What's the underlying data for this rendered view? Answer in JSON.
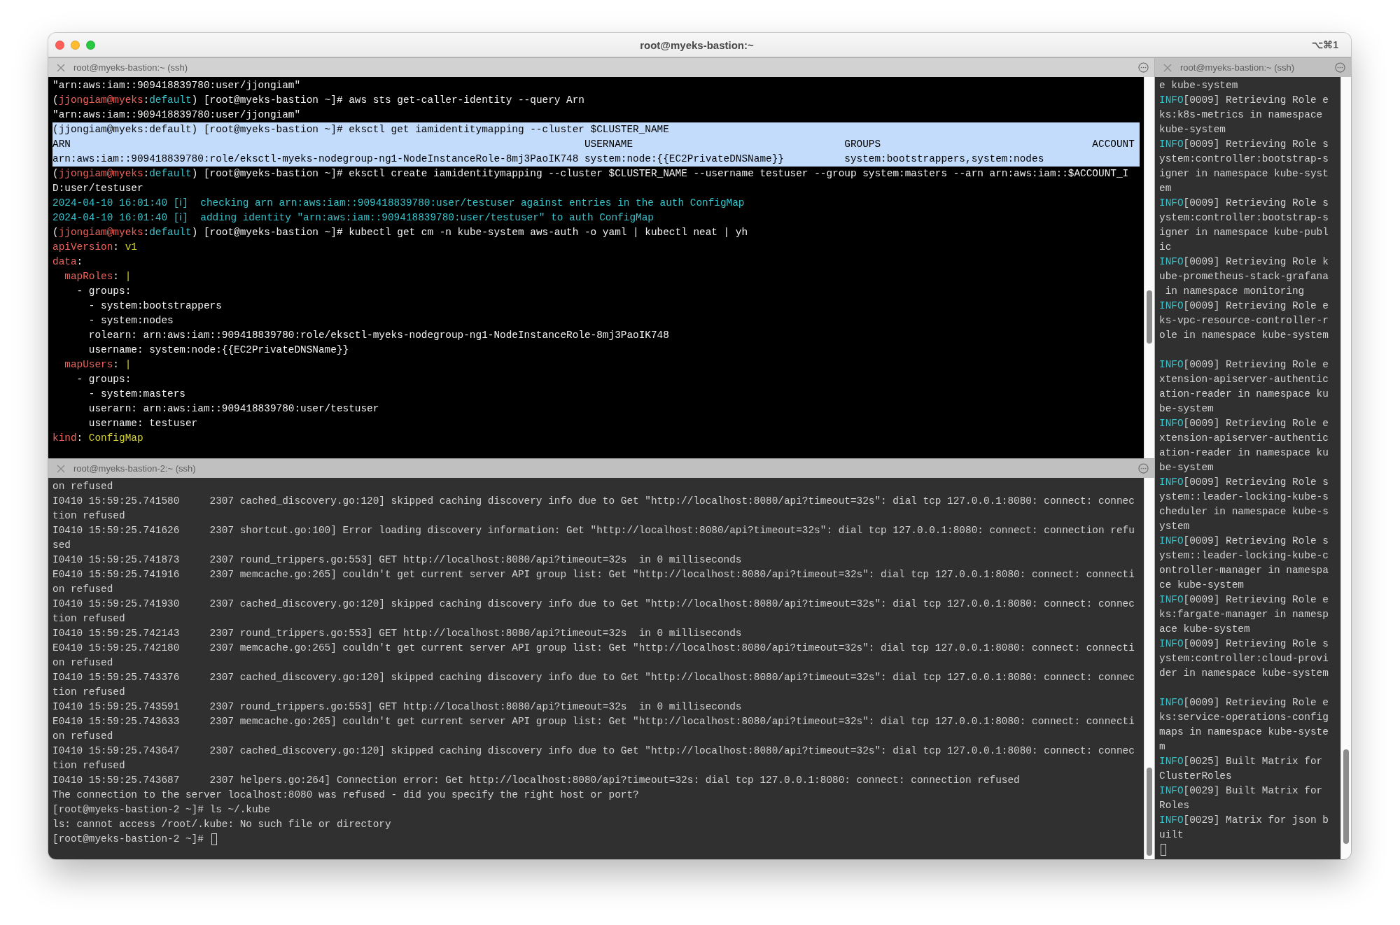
{
  "window": {
    "title": "root@myeks-bastion:~",
    "shortcut": "⌥⌘1"
  },
  "panes": [
    {
      "title": "root@myeks-bastion:~ (ssh)",
      "active": true,
      "lines": [
        {
          "kind": "text",
          "selected": false,
          "segments": [
            {
              "kind": "plain",
              "text": "\"arn:aws:iam::909418839780:user/jjongiam\""
            }
          ]
        },
        {
          "kind": "text",
          "selected": false,
          "segments": [
            {
              "kind": "plain",
              "text": "("
            },
            {
              "kind": "user",
              "text": "jjongiam@myeks"
            },
            {
              "kind": "plain",
              "text": ":"
            },
            {
              "kind": "context",
              "text": "default"
            },
            {
              "kind": "plain",
              "text": ") [root@myeks-bastion ~]# aws sts get-caller-identity --query Arn"
            }
          ]
        },
        {
          "kind": "text",
          "selected": false,
          "segments": [
            {
              "kind": "plain",
              "text": "\"arn:aws:iam::909418839780:user/jjongiam\""
            }
          ]
        },
        {
          "kind": "text",
          "selected": true,
          "segments": [
            {
              "kind": "plain",
              "text": "(jjongiam@myeks:default) [root@myeks-bastion ~]# eksctl get iamidentitymapping --cluster $CLUSTER_NAME"
            }
          ]
        },
        {
          "kind": "text",
          "selected": true,
          "segments": [
            {
              "kind": "plain",
              "text": "ARN                                                                                     USERNAME                                   GROUPS                                   ACCOUNT"
            }
          ]
        },
        {
          "kind": "text",
          "selected": true,
          "segments": [
            {
              "kind": "plain",
              "text": "arn:aws:iam::909418839780:role/eksctl-myeks-nodegroup-ng1-NodeInstanceRole-8mj3PaoIK748 system:node:{{EC2PrivateDNSName}}          system:bootstrappers,system:nodes"
            }
          ]
        },
        {
          "kind": "text",
          "selected": false,
          "segments": [
            {
              "kind": "plain",
              "text": "("
            },
            {
              "kind": "user",
              "text": "jjongiam@myeks"
            },
            {
              "kind": "plain",
              "text": ":"
            },
            {
              "kind": "context",
              "text": "default"
            },
            {
              "kind": "plain",
              "text": ") [root@myeks-bastion ~]# eksctl create iamidentitymapping --cluster $CLUSTER_NAME --username testuser --group system:masters --arn arn:aws:iam::$ACCOUNT_I"
            }
          ]
        },
        {
          "kind": "text",
          "selected": false,
          "segments": [
            {
              "kind": "plain",
              "text": "D:user/testuser"
            }
          ]
        },
        {
          "kind": "text",
          "selected": false,
          "segments": [
            {
              "kind": "info",
              "text": "2024-04-10 16:01:40 [ℹ]  checking arn arn:aws:iam::909418839780:user/testuser against entries in the auth ConfigMap"
            }
          ]
        },
        {
          "kind": "text",
          "selected": false,
          "segments": [
            {
              "kind": "info",
              "text": "2024-04-10 16:01:40 [ℹ]  adding identity \"arn:aws:iam::909418839780:user/testuser\" to auth ConfigMap"
            }
          ]
        },
        {
          "kind": "text",
          "selected": false,
          "segments": [
            {
              "kind": "plain",
              "text": "("
            },
            {
              "kind": "user",
              "text": "jjongiam@myeks"
            },
            {
              "kind": "plain",
              "text": ":"
            },
            {
              "kind": "context",
              "text": "default"
            },
            {
              "kind": "plain",
              "text": ") [root@myeks-bastion ~]# kubectl get cm -n kube-system aws-auth -o yaml | kubectl neat | yh"
            }
          ]
        },
        {
          "kind": "text",
          "selected": false,
          "segments": [
            {
              "kind": "key",
              "text": "apiVersion"
            },
            {
              "kind": "plain",
              "text": ": "
            },
            {
              "kind": "value",
              "text": "v1"
            }
          ]
        },
        {
          "kind": "text",
          "selected": false,
          "segments": [
            {
              "kind": "key",
              "text": "data"
            },
            {
              "kind": "plain",
              "text": ":"
            }
          ]
        },
        {
          "kind": "text",
          "selected": false,
          "segments": [
            {
              "kind": "key",
              "text": "  mapRoles"
            },
            {
              "kind": "plain",
              "text": ": "
            },
            {
              "kind": "value",
              "text": "|"
            }
          ]
        },
        {
          "kind": "text",
          "selected": false,
          "segments": [
            {
              "kind": "plain",
              "text": "    - groups:"
            }
          ]
        },
        {
          "kind": "text",
          "selected": false,
          "segments": [
            {
              "kind": "plain",
              "text": "      - system:bootstrappers"
            }
          ]
        },
        {
          "kind": "text",
          "selected": false,
          "segments": [
            {
              "kind": "plain",
              "text": "      - system:nodes"
            }
          ]
        },
        {
          "kind": "text",
          "selected": false,
          "segments": [
            {
              "kind": "plain",
              "text": "      rolearn: arn:aws:iam::909418839780:role/eksctl-myeks-nodegroup-ng1-NodeInstanceRole-8mj3PaoIK748"
            }
          ]
        },
        {
          "kind": "text",
          "selected": false,
          "segments": [
            {
              "kind": "plain",
              "text": "      username: system:node:{{EC2PrivateDNSName}}"
            }
          ]
        },
        {
          "kind": "text",
          "selected": false,
          "segments": [
            {
              "kind": "key",
              "text": "  mapUsers"
            },
            {
              "kind": "plain",
              "text": ": "
            },
            {
              "kind": "value",
              "text": "|"
            }
          ]
        },
        {
          "kind": "text",
          "selected": false,
          "segments": [
            {
              "kind": "plain",
              "text": "    - groups:"
            }
          ]
        },
        {
          "kind": "text",
          "selected": false,
          "segments": [
            {
              "kind": "plain",
              "text": "      - system:masters"
            }
          ]
        },
        {
          "kind": "text",
          "selected": false,
          "segments": [
            {
              "kind": "plain",
              "text": "      userarn: arn:aws:iam::909418839780:user/testuser"
            }
          ]
        },
        {
          "kind": "text",
          "selected": false,
          "segments": [
            {
              "kind": "plain",
              "text": "      username: testuser"
            }
          ]
        },
        {
          "kind": "text",
          "selected": false,
          "segments": [
            {
              "kind": "key",
              "text": "kind"
            },
            {
              "kind": "plain",
              "text": ": "
            },
            {
              "kind": "value",
              "text": "ConfigMap"
            }
          ]
        }
      ]
    },
    {
      "title": "root@myeks-bastion-2:~ (ssh)",
      "active": false,
      "lines": [
        {
          "kind": "text",
          "segments": [
            {
              "kind": "plain",
              "text": "on refused"
            }
          ]
        },
        {
          "kind": "text",
          "segments": [
            {
              "kind": "plain",
              "text": "I0410 15:59:25.741580     2307 cached_discovery.go:120] skipped caching discovery info due to Get \"http://localhost:8080/api?timeout=32s\": dial tcp 127.0.0.1:8080: connect: connec"
            }
          ]
        },
        {
          "kind": "text",
          "segments": [
            {
              "kind": "plain",
              "text": "tion refused"
            }
          ]
        },
        {
          "kind": "text",
          "segments": [
            {
              "kind": "plain",
              "text": "I0410 15:59:25.741626     2307 shortcut.go:100] Error loading discovery information: Get \"http://localhost:8080/api?timeout=32s\": dial tcp 127.0.0.1:8080: connect: connection refu"
            }
          ]
        },
        {
          "kind": "text",
          "segments": [
            {
              "kind": "plain",
              "text": "sed"
            }
          ]
        },
        {
          "kind": "text",
          "segments": [
            {
              "kind": "plain",
              "text": "I0410 15:59:25.741873     2307 round_trippers.go:553] GET http://localhost:8080/api?timeout=32s  in 0 milliseconds"
            }
          ]
        },
        {
          "kind": "text",
          "segments": [
            {
              "kind": "plain",
              "text": "E0410 15:59:25.741916     2307 memcache.go:265] couldn't get current server API group list: Get \"http://localhost:8080/api?timeout=32s\": dial tcp 127.0.0.1:8080: connect: connecti"
            }
          ]
        },
        {
          "kind": "text",
          "segments": [
            {
              "kind": "plain",
              "text": "on refused"
            }
          ]
        },
        {
          "kind": "text",
          "segments": [
            {
              "kind": "plain",
              "text": "I0410 15:59:25.741930     2307 cached_discovery.go:120] skipped caching discovery info due to Get \"http://localhost:8080/api?timeout=32s\": dial tcp 127.0.0.1:8080: connect: connec"
            }
          ]
        },
        {
          "kind": "text",
          "segments": [
            {
              "kind": "plain",
              "text": "tion refused"
            }
          ]
        },
        {
          "kind": "text",
          "segments": [
            {
              "kind": "plain",
              "text": "I0410 15:59:25.742143     2307 round_trippers.go:553] GET http://localhost:8080/api?timeout=32s  in 0 milliseconds"
            }
          ]
        },
        {
          "kind": "text",
          "segments": [
            {
              "kind": "plain",
              "text": "E0410 15:59:25.742180     2307 memcache.go:265] couldn't get current server API group list: Get \"http://localhost:8080/api?timeout=32s\": dial tcp 127.0.0.1:8080: connect: connecti"
            }
          ]
        },
        {
          "kind": "text",
          "segments": [
            {
              "kind": "plain",
              "text": "on refused"
            }
          ]
        },
        {
          "kind": "text",
          "segments": [
            {
              "kind": "plain",
              "text": "I0410 15:59:25.743376     2307 cached_discovery.go:120] skipped caching discovery info due to Get \"http://localhost:8080/api?timeout=32s\": dial tcp 127.0.0.1:8080: connect: connec"
            }
          ]
        },
        {
          "kind": "text",
          "segments": [
            {
              "kind": "plain",
              "text": "tion refused"
            }
          ]
        },
        {
          "kind": "text",
          "segments": [
            {
              "kind": "plain",
              "text": "I0410 15:59:25.743591     2307 round_trippers.go:553] GET http://localhost:8080/api?timeout=32s  in 0 milliseconds"
            }
          ]
        },
        {
          "kind": "text",
          "segments": [
            {
              "kind": "plain",
              "text": "E0410 15:59:25.743633     2307 memcache.go:265] couldn't get current server API group list: Get \"http://localhost:8080/api?timeout=32s\": dial tcp 127.0.0.1:8080: connect: connecti"
            }
          ]
        },
        {
          "kind": "text",
          "segments": [
            {
              "kind": "plain",
              "text": "on refused"
            }
          ]
        },
        {
          "kind": "text",
          "segments": [
            {
              "kind": "plain",
              "text": "I0410 15:59:25.743647     2307 cached_discovery.go:120] skipped caching discovery info due to Get \"http://localhost:8080/api?timeout=32s\": dial tcp 127.0.0.1:8080: connect: connec"
            }
          ]
        },
        {
          "kind": "text",
          "segments": [
            {
              "kind": "plain",
              "text": "tion refused"
            }
          ]
        },
        {
          "kind": "text",
          "segments": [
            {
              "kind": "plain",
              "text": "I0410 15:59:25.743687     2307 helpers.go:264] Connection error: Get http://localhost:8080/api?timeout=32s: dial tcp 127.0.0.1:8080: connect: connection refused"
            }
          ]
        },
        {
          "kind": "text",
          "segments": [
            {
              "kind": "plain",
              "text": "The connection to the server localhost:8080 was refused - did you specify the right host or port?"
            }
          ]
        },
        {
          "kind": "text",
          "segments": [
            {
              "kind": "plain",
              "text": "[root@myeks-bastion-2 ~]# ls ~/.kube"
            }
          ]
        },
        {
          "kind": "text",
          "segments": [
            {
              "kind": "plain",
              "text": "ls: cannot access /root/.kube: No such file or directory"
            }
          ]
        },
        {
          "kind": "text",
          "cursor": true,
          "segments": [
            {
              "kind": "plain",
              "text": "[root@myeks-bastion-2 ~]# "
            }
          ]
        }
      ]
    },
    {
      "title": "root@myeks-bastion:~ (ssh)",
      "active": false,
      "lines": [
        {
          "kind": "text",
          "segments": [
            {
              "kind": "plain",
              "text": "e kube-system"
            }
          ]
        },
        {
          "kind": "text",
          "segments": [
            {
              "kind": "info",
              "text": "INFO"
            },
            {
              "kind": "plain",
              "text": "[0009] Retrieving Role e"
            }
          ]
        },
        {
          "kind": "text",
          "segments": [
            {
              "kind": "plain",
              "text": "ks:k8s-metrics in namespace"
            }
          ]
        },
        {
          "kind": "text",
          "segments": [
            {
              "kind": "plain",
              "text": "kube-system"
            }
          ]
        },
        {
          "kind": "text",
          "segments": [
            {
              "kind": "info",
              "text": "INFO"
            },
            {
              "kind": "plain",
              "text": "[0009] Retrieving Role s"
            }
          ]
        },
        {
          "kind": "text",
          "segments": [
            {
              "kind": "plain",
              "text": "ystem:controller:bootstrap-s"
            }
          ]
        },
        {
          "kind": "text",
          "segments": [
            {
              "kind": "plain",
              "text": "igner in namespace kube-syst"
            }
          ]
        },
        {
          "kind": "text",
          "segments": [
            {
              "kind": "plain",
              "text": "em"
            }
          ]
        },
        {
          "kind": "text",
          "segments": [
            {
              "kind": "info",
              "text": "INFO"
            },
            {
              "kind": "plain",
              "text": "[0009] Retrieving Role s"
            }
          ]
        },
        {
          "kind": "text",
          "segments": [
            {
              "kind": "plain",
              "text": "ystem:controller:bootstrap-s"
            }
          ]
        },
        {
          "kind": "text",
          "segments": [
            {
              "kind": "plain",
              "text": "igner in namespace kube-publ"
            }
          ]
        },
        {
          "kind": "text",
          "segments": [
            {
              "kind": "plain",
              "text": "ic"
            }
          ]
        },
        {
          "kind": "text",
          "segments": [
            {
              "kind": "info",
              "text": "INFO"
            },
            {
              "kind": "plain",
              "text": "[0009] Retrieving Role k"
            }
          ]
        },
        {
          "kind": "text",
          "segments": [
            {
              "kind": "plain",
              "text": "ube-prometheus-stack-grafana"
            }
          ]
        },
        {
          "kind": "text",
          "segments": [
            {
              "kind": "plain",
              "text": " in namespace monitoring"
            }
          ]
        },
        {
          "kind": "text",
          "segments": [
            {
              "kind": "info",
              "text": "INFO"
            },
            {
              "kind": "plain",
              "text": "[0009] Retrieving Role e"
            }
          ]
        },
        {
          "kind": "text",
          "segments": [
            {
              "kind": "plain",
              "text": "ks-vpc-resource-controller-r"
            }
          ]
        },
        {
          "kind": "text",
          "segments": [
            {
              "kind": "plain",
              "text": "ole in namespace kube-system"
            }
          ]
        },
        {
          "kind": "blank"
        },
        {
          "kind": "text",
          "segments": [
            {
              "kind": "info",
              "text": "INFO"
            },
            {
              "kind": "plain",
              "text": "[0009] Retrieving Role e"
            }
          ]
        },
        {
          "kind": "text",
          "segments": [
            {
              "kind": "plain",
              "text": "xtension-apiserver-authentic"
            }
          ]
        },
        {
          "kind": "text",
          "segments": [
            {
              "kind": "plain",
              "text": "ation-reader in namespace ku"
            }
          ]
        },
        {
          "kind": "text",
          "segments": [
            {
              "kind": "plain",
              "text": "be-system"
            }
          ]
        },
        {
          "kind": "text",
          "segments": [
            {
              "kind": "info",
              "text": "INFO"
            },
            {
              "kind": "plain",
              "text": "[0009] Retrieving Role e"
            }
          ]
        },
        {
          "kind": "text",
          "segments": [
            {
              "kind": "plain",
              "text": "xtension-apiserver-authentic"
            }
          ]
        },
        {
          "kind": "text",
          "segments": [
            {
              "kind": "plain",
              "text": "ation-reader in namespace ku"
            }
          ]
        },
        {
          "kind": "text",
          "segments": [
            {
              "kind": "plain",
              "text": "be-system"
            }
          ]
        },
        {
          "kind": "text",
          "segments": [
            {
              "kind": "info",
              "text": "INFO"
            },
            {
              "kind": "plain",
              "text": "[0009] Retrieving Role s"
            }
          ]
        },
        {
          "kind": "text",
          "segments": [
            {
              "kind": "plain",
              "text": "ystem::leader-locking-kube-s"
            }
          ]
        },
        {
          "kind": "text",
          "segments": [
            {
              "kind": "plain",
              "text": "cheduler in namespace kube-s"
            }
          ]
        },
        {
          "kind": "text",
          "segments": [
            {
              "kind": "plain",
              "text": "ystem"
            }
          ]
        },
        {
          "kind": "text",
          "segments": [
            {
              "kind": "info",
              "text": "INFO"
            },
            {
              "kind": "plain",
              "text": "[0009] Retrieving Role s"
            }
          ]
        },
        {
          "kind": "text",
          "segments": [
            {
              "kind": "plain",
              "text": "ystem::leader-locking-kube-c"
            }
          ]
        },
        {
          "kind": "text",
          "segments": [
            {
              "kind": "plain",
              "text": "ontroller-manager in namespa"
            }
          ]
        },
        {
          "kind": "text",
          "segments": [
            {
              "kind": "plain",
              "text": "ce kube-system"
            }
          ]
        },
        {
          "kind": "text",
          "segments": [
            {
              "kind": "info",
              "text": "INFO"
            },
            {
              "kind": "plain",
              "text": "[0009] Retrieving Role e"
            }
          ]
        },
        {
          "kind": "text",
          "segments": [
            {
              "kind": "plain",
              "text": "ks:fargate-manager in namesp"
            }
          ]
        },
        {
          "kind": "text",
          "segments": [
            {
              "kind": "plain",
              "text": "ace kube-system"
            }
          ]
        },
        {
          "kind": "text",
          "segments": [
            {
              "kind": "info",
              "text": "INFO"
            },
            {
              "kind": "plain",
              "text": "[0009] Retrieving Role s"
            }
          ]
        },
        {
          "kind": "text",
          "segments": [
            {
              "kind": "plain",
              "text": "ystem:controller:cloud-provi"
            }
          ]
        },
        {
          "kind": "text",
          "segments": [
            {
              "kind": "plain",
              "text": "der in namespace kube-system"
            }
          ]
        },
        {
          "kind": "blank"
        },
        {
          "kind": "text",
          "segments": [
            {
              "kind": "info",
              "text": "INFO"
            },
            {
              "kind": "plain",
              "text": "[0009] Retrieving Role e"
            }
          ]
        },
        {
          "kind": "text",
          "segments": [
            {
              "kind": "plain",
              "text": "ks:service-operations-config"
            }
          ]
        },
        {
          "kind": "text",
          "segments": [
            {
              "kind": "plain",
              "text": "maps in namespace kube-syste"
            }
          ]
        },
        {
          "kind": "text",
          "segments": [
            {
              "kind": "plain",
              "text": "m"
            }
          ]
        },
        {
          "kind": "text",
          "segments": [
            {
              "kind": "info",
              "text": "INFO"
            },
            {
              "kind": "plain",
              "text": "[0025] Built Matrix for"
            }
          ]
        },
        {
          "kind": "text",
          "segments": [
            {
              "kind": "plain",
              "text": "ClusterRoles"
            }
          ]
        },
        {
          "kind": "text",
          "segments": [
            {
              "kind": "info",
              "text": "INFO"
            },
            {
              "kind": "plain",
              "text": "[0029] Built Matrix for"
            }
          ]
        },
        {
          "kind": "text",
          "segments": [
            {
              "kind": "plain",
              "text": "Roles"
            }
          ]
        },
        {
          "kind": "text",
          "segments": [
            {
              "kind": "info",
              "text": "INFO"
            },
            {
              "kind": "plain",
              "text": "[0029] Matrix for json b"
            }
          ]
        },
        {
          "kind": "text",
          "segments": [
            {
              "kind": "plain",
              "text": "uilt"
            }
          ]
        },
        {
          "kind": "text",
          "cursor": true
        }
      ]
    }
  ]
}
